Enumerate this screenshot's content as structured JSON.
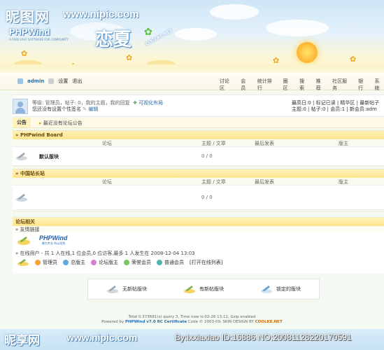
{
  "watermark": {
    "top_brand": "昵图网",
    "top_url": "www.nipic.com",
    "bottom_brand": "昵享网",
    "bottom_url": "www.nipic.com",
    "bottom_right": "By:lxxiaxiao  ID:16886  NO:20081128220170591"
  },
  "banner": {
    "logo": "PHPWind",
    "logo_sub": "A FREE EASY SOFTWARE FOR COMMUNITY",
    "title": "恋夏",
    "badge": "COOLKE.NET"
  },
  "nav": {
    "user": "admin",
    "settings": "设置",
    "logout": "退出",
    "links": [
      "讨论区",
      "会员",
      "统计排行",
      "圈区",
      "搜索",
      "推荐",
      "社区服务",
      "银行",
      "系统"
    ]
  },
  "userbox": {
    "line1": "等级: 管理员，帖子: 0，我的主题，我的回复",
    "visual_layout": "可视化布局",
    "line2": "您还没有设置个性签名",
    "edit": "编辑",
    "right1": "最高日:0 | 标记已读 | 精华区 | 最新帖子",
    "right2": "主题:0 | 帖子:0 | 会员:1 | 新会员:adm"
  },
  "notice": {
    "tab": "公告",
    "text": "最近没有论坛公告"
  },
  "boards": [
    {
      "title": "» PHPwind Board",
      "cols": {
        "forum": "论坛",
        "topics": "主题 / 文章",
        "last": "最后发表",
        "mod": "版主"
      },
      "forum_name": "默认版块",
      "stats": "0 / 0"
    },
    {
      "title": "» 中国站长站",
      "cols": {
        "forum": "论坛",
        "topics": "主题 / 文章",
        "last": "最后发表",
        "mod": "版主"
      },
      "forum_name": "",
      "stats": "0 / 0"
    }
  ],
  "related": {
    "title": "论坛相关",
    "friend_links": "» 友情链接",
    "partner_logo": "PHPWind",
    "partner_sub": "做为专业 所以优秀",
    "online": "» 在线用户 - 共 1 人在线,1 位会员,0 位访客,最多 1 人发生在 2008-12-04 13:03",
    "legend": [
      "管理员",
      "总版主",
      "论坛版主",
      "荣誉会员",
      "普通会员",
      "[打开在线列表]"
    ]
  },
  "status_legend": [
    "无新帖版块",
    "有新帖版块",
    "锁定的版块"
  ],
  "footer": {
    "line1": "Total 0.373691(s) query 3, Time now is:02-26 13:11, Gzip enabled",
    "line2_pre": "Powered by",
    "line2_brand": "PHPWind v7.0 RC Certificate",
    "line2_post": "Code © 2003-09, SKIN DESIGN BY",
    "line2_design": "COOLKE.NET"
  }
}
